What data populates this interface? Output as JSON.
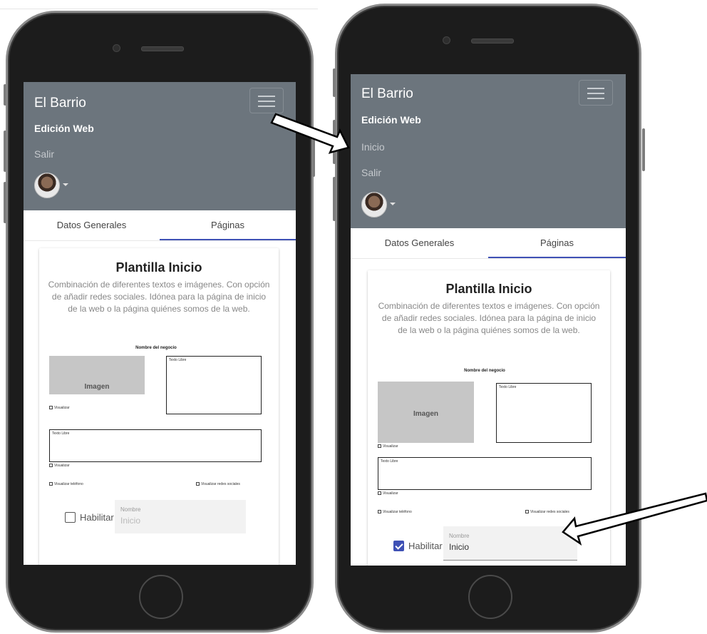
{
  "app": {
    "brand": "El Barrio",
    "accent_color": "#3f51b5",
    "navbar_color": "#6c757d"
  },
  "before": {
    "nav_links": [
      "Edición Web",
      "Salir"
    ],
    "habilitar_checked": false
  },
  "after": {
    "nav_links": [
      "Edición Web",
      "Inicio",
      "Salir"
    ],
    "habilitar_checked": true
  },
  "tabs": [
    "Datos Generales",
    "Páginas"
  ],
  "active_tab": "Páginas",
  "template_card": {
    "title": "Plantilla Inicio",
    "description": "Combinación de diferentes textos e imágenes. Con opción de añadir redes sociales. Idónea para la página de inicio de la web o la página quiénes somos de la web.",
    "mockup": {
      "business_name": "Nombre del negocio",
      "image_label": "Imagen",
      "free_text_label": "Texto Libre",
      "show_label": "Visualizar",
      "show_phone_label": "Visualizar teléfono",
      "show_social_label": "Visualizar redes sociales"
    },
    "enable_label": "Habilitar",
    "name_field": {
      "label": "Nombre",
      "value": "Inicio"
    }
  },
  "icons": [
    "menu-icon",
    "avatar",
    "caret-down-icon",
    "arrow-icon"
  ]
}
